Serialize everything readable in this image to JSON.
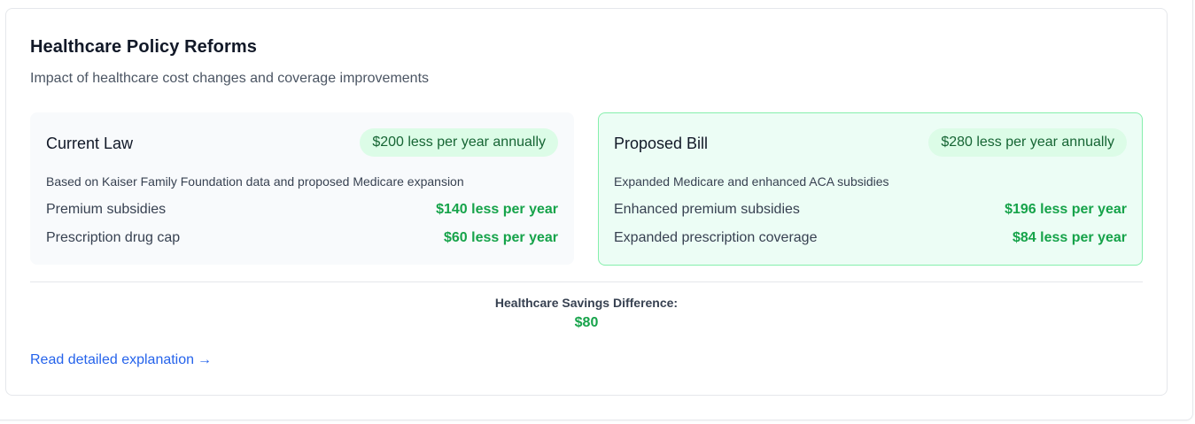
{
  "card": {
    "title": "Healthcare Policy Reforms",
    "subtitle": "Impact of healthcare cost changes and coverage improvements"
  },
  "current_law": {
    "title": "Current Law",
    "badge": "$200 less per year annually",
    "description": "Based on Kaiser Family Foundation data and proposed Medicare expansion",
    "rows": [
      {
        "label": "Premium subsidies",
        "value": "$140 less per year"
      },
      {
        "label": "Prescription drug cap",
        "value": "$60 less per year"
      }
    ]
  },
  "proposed_bill": {
    "title": "Proposed Bill",
    "badge": "$280 less per year annually",
    "description": "Expanded Medicare and enhanced ACA subsidies",
    "rows": [
      {
        "label": "Enhanced premium subsidies",
        "value": "$196 less per year"
      },
      {
        "label": "Expanded prescription coverage",
        "value": "$84 less per year"
      }
    ]
  },
  "difference": {
    "label": "Healthcare Savings Difference:",
    "value": "$80"
  },
  "link": {
    "text": "Read detailed explanation",
    "arrow": "→"
  },
  "colors": {
    "accent_green": "#16a34a",
    "badge_bg": "#dcfce7",
    "proposed_bg": "#ecfdf5",
    "proposed_border": "#86efac",
    "link_blue": "#2563eb"
  }
}
